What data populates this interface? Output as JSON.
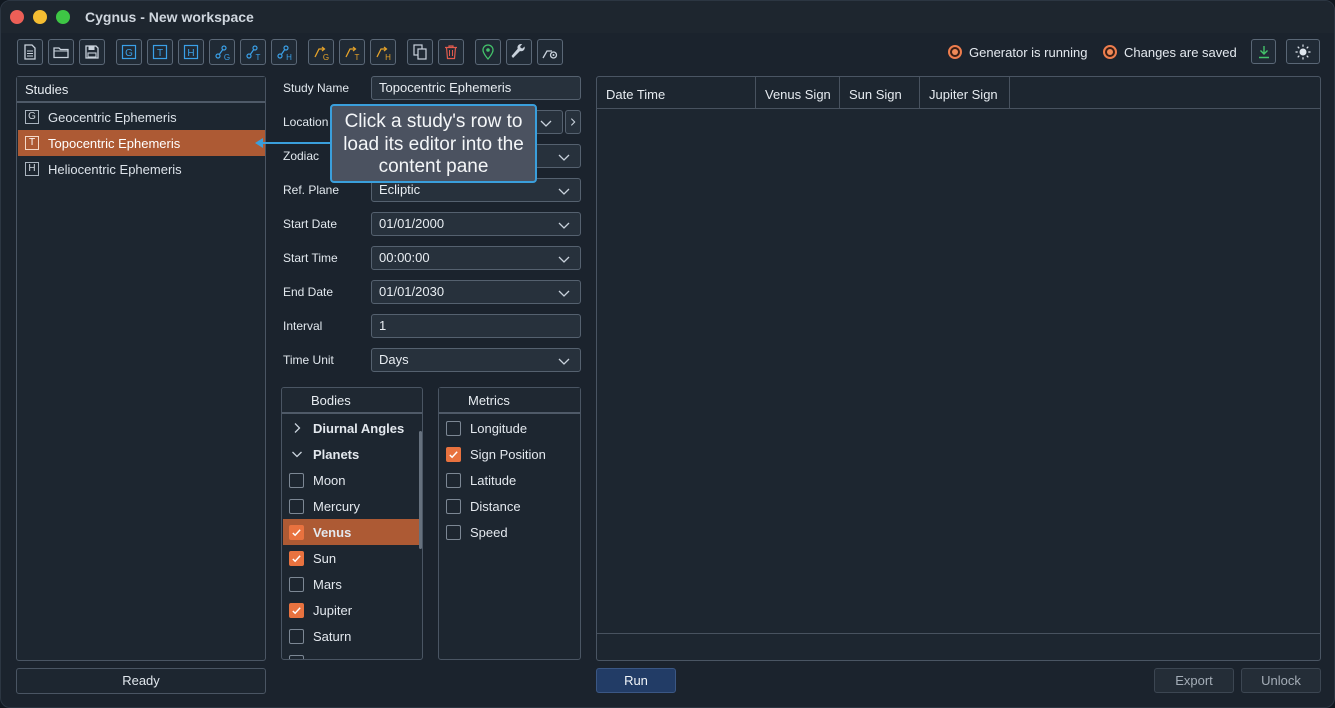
{
  "window": {
    "title": "Cygnus - New workspace"
  },
  "toolbar": {
    "icons": [
      {
        "name": "new-file-icon",
        "color": "#c9d2dc"
      },
      {
        "name": "open-folder-icon",
        "color": "#c9d2dc"
      },
      {
        "name": "save-icon",
        "color": "#c9d2dc"
      },
      {
        "name": "geocentric-study-icon",
        "letter": "G",
        "color": "#3aa0e8"
      },
      {
        "name": "topocentric-study-icon",
        "letter": "T",
        "color": "#3aa0e8"
      },
      {
        "name": "heliocentric-study-icon",
        "letter": "H",
        "color": "#3aa0e8"
      },
      {
        "name": "geocentric-chart-icon",
        "letter": "G",
        "color": "#3aa0e8"
      },
      {
        "name": "topocentric-chart-icon",
        "letter": "T",
        "color": "#3aa0e8"
      },
      {
        "name": "heliocentric-chart-icon",
        "letter": "H",
        "color": "#3aa0e8"
      },
      {
        "name": "geocentric-transit-icon",
        "letter": "G",
        "color": "#e6a329"
      },
      {
        "name": "topocentric-transit-icon",
        "letter": "T",
        "color": "#e6a329"
      },
      {
        "name": "heliocentric-transit-icon",
        "letter": "H",
        "color": "#e6a329"
      },
      {
        "name": "copy-icon",
        "color": "#c9d2dc"
      },
      {
        "name": "trash-icon",
        "color": "#e05b4e"
      },
      {
        "name": "location-pin-icon",
        "color": "#43c26a"
      },
      {
        "name": "wrench-icon",
        "color": "#c9d2dc"
      },
      {
        "name": "settings-chart-icon",
        "color": "#c9d2dc"
      }
    ],
    "status_generator": "Generator is running",
    "status_saved": "Changes are saved",
    "download_icon_color": "#43c26a",
    "theme_icon": "sun-icon"
  },
  "studies": {
    "header": "Studies",
    "items": [
      {
        "badge": "G",
        "label": "Geocentric Ephemeris",
        "selected": false
      },
      {
        "badge": "T",
        "label": "Topocentric Ephemeris",
        "selected": true
      },
      {
        "badge": "H",
        "label": "Heliocentric Ephemeris",
        "selected": false
      }
    ],
    "status": "Ready"
  },
  "form": {
    "study_name_label": "Study Name",
    "study_name_value": "Topocentric Ephemeris",
    "location_label": "Location",
    "zodiac_label": "Zodiac",
    "ref_plane_label": "Ref. Plane",
    "ref_plane_value": "Ecliptic",
    "start_date_label": "Start Date",
    "start_date_value": "01/01/2000",
    "start_time_label": "Start Time",
    "start_time_value": "00:00:00",
    "end_date_label": "End Date",
    "end_date_value": "01/01/2030",
    "interval_label": "Interval",
    "interval_value": "1",
    "time_unit_label": "Time Unit",
    "time_unit_value": "Days"
  },
  "bodies": {
    "header": "Bodies",
    "items": [
      {
        "type": "group",
        "label": "Diurnal Angles",
        "expanded": false
      },
      {
        "type": "group",
        "label": "Planets",
        "expanded": true
      },
      {
        "type": "item",
        "label": "Moon",
        "checked": false
      },
      {
        "type": "item",
        "label": "Mercury",
        "checked": false
      },
      {
        "type": "item",
        "label": "Venus",
        "checked": true,
        "selected": true
      },
      {
        "type": "item",
        "label": "Sun",
        "checked": true
      },
      {
        "type": "item",
        "label": "Mars",
        "checked": false
      },
      {
        "type": "item",
        "label": "Jupiter",
        "checked": true
      },
      {
        "type": "item",
        "label": "Saturn",
        "checked": false
      }
    ]
  },
  "metrics": {
    "header": "Metrics",
    "items": [
      {
        "label": "Longitude",
        "checked": false
      },
      {
        "label": "Sign Position",
        "checked": true
      },
      {
        "label": "Latitude",
        "checked": false
      },
      {
        "label": "Distance",
        "checked": false
      },
      {
        "label": "Speed",
        "checked": false
      }
    ]
  },
  "results": {
    "columns": [
      "Date Time",
      "Venus Sign",
      "Sun Sign",
      "Jupiter Sign"
    ]
  },
  "actions": {
    "run": "Run",
    "export": "Export",
    "unlock": "Unlock"
  },
  "tooltip": {
    "text": "Click a study's row to load its editor into the content pane"
  }
}
